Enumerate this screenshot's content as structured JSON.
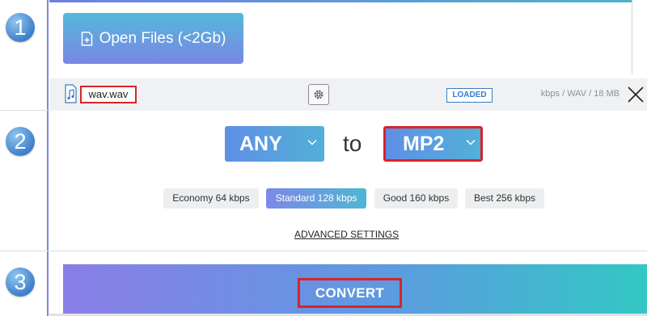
{
  "steps": [
    "1",
    "2",
    "3"
  ],
  "open_files": {
    "label": "Open Files (<2Gb)"
  },
  "file": {
    "name": "wav.wav",
    "status": "LOADED",
    "info": "kbps / WAV / 18 MB"
  },
  "convert_from": {
    "format": "ANY"
  },
  "connector": "to",
  "convert_to": {
    "format": "MP2"
  },
  "quality_presets": [
    {
      "label": "Economy 64 kbps",
      "selected": false
    },
    {
      "label": "Standard 128 kbps",
      "selected": true
    },
    {
      "label": "Good 160 kbps",
      "selected": false
    },
    {
      "label": "Best 256 kbps",
      "selected": false
    }
  ],
  "advanced_settings": "ADVANCED SETTINGS",
  "convert_button": "CONVERT",
  "colors": {
    "accent_blue": "#3a7bc8",
    "highlight_red": "#d8232a",
    "gradient_start": "#7d88e8",
    "gradient_end": "#4fb6d3"
  },
  "icons": [
    "file-plus-icon",
    "music-note-icon",
    "gear-icon",
    "close-icon",
    "chevron-down-icon"
  ]
}
